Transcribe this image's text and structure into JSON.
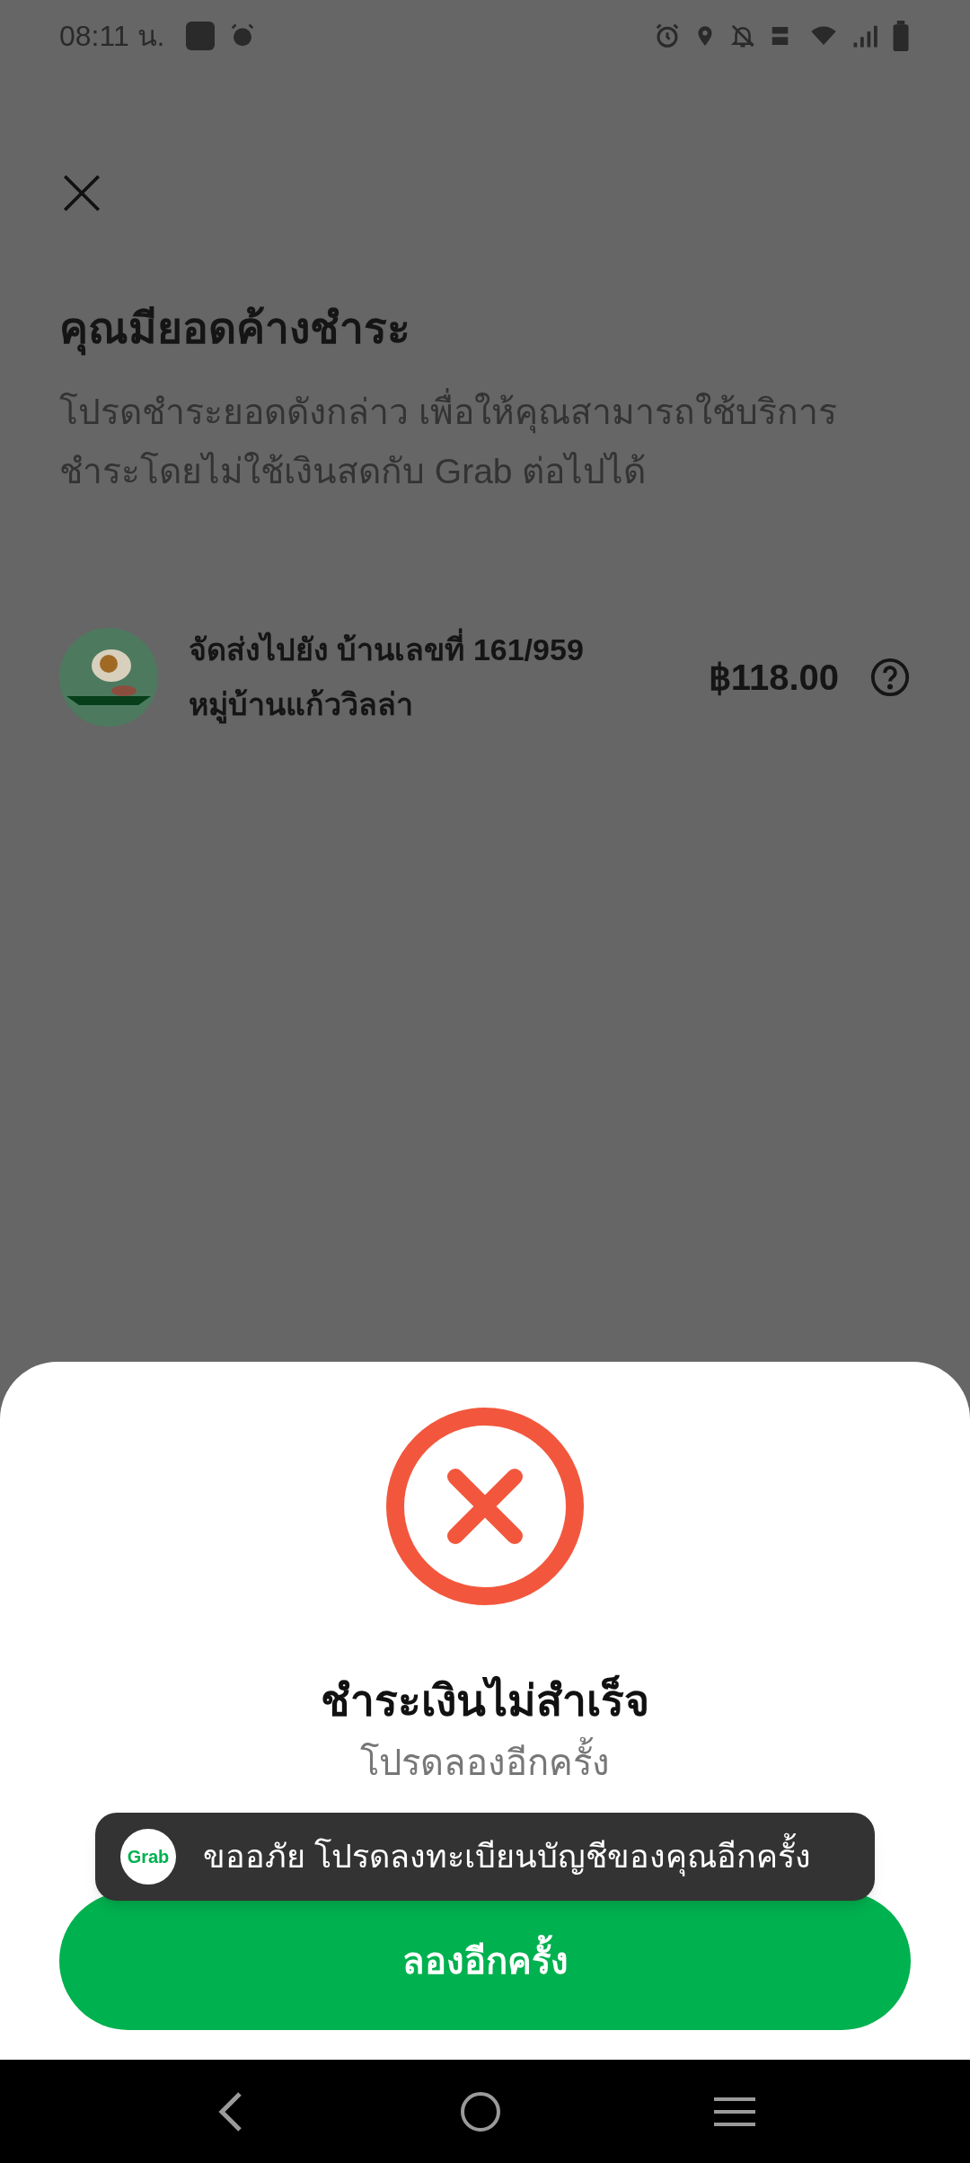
{
  "status_bar": {
    "time": "08:11 น."
  },
  "header": {
    "title": "คุณมียอดค้างชำระ",
    "description": "โปรดชำระยอดดังกล่าว เพื่อให้คุณสามารถใช้บริการชำระโดยไม่ใช้เงินสดกับ Grab ต่อไปได้"
  },
  "orders": [
    {
      "line_1": "จัดส่งไปยัง บ้านเลขที่ 161/959",
      "line_2": "หมู่บ้านแก้ววิลล่า",
      "amount": "฿118.00"
    }
  ],
  "sheet": {
    "title": "ชำระเงินไม่สำเร็จ",
    "subtitle": "โปรดลองอีกครั้ง",
    "button": "ลองอีกครั้ง"
  },
  "toast": {
    "logo_text": "Grab",
    "message": "ขออภัย โปรดลงทะเบียนบัญชีของคุณอีกครั้ง"
  }
}
